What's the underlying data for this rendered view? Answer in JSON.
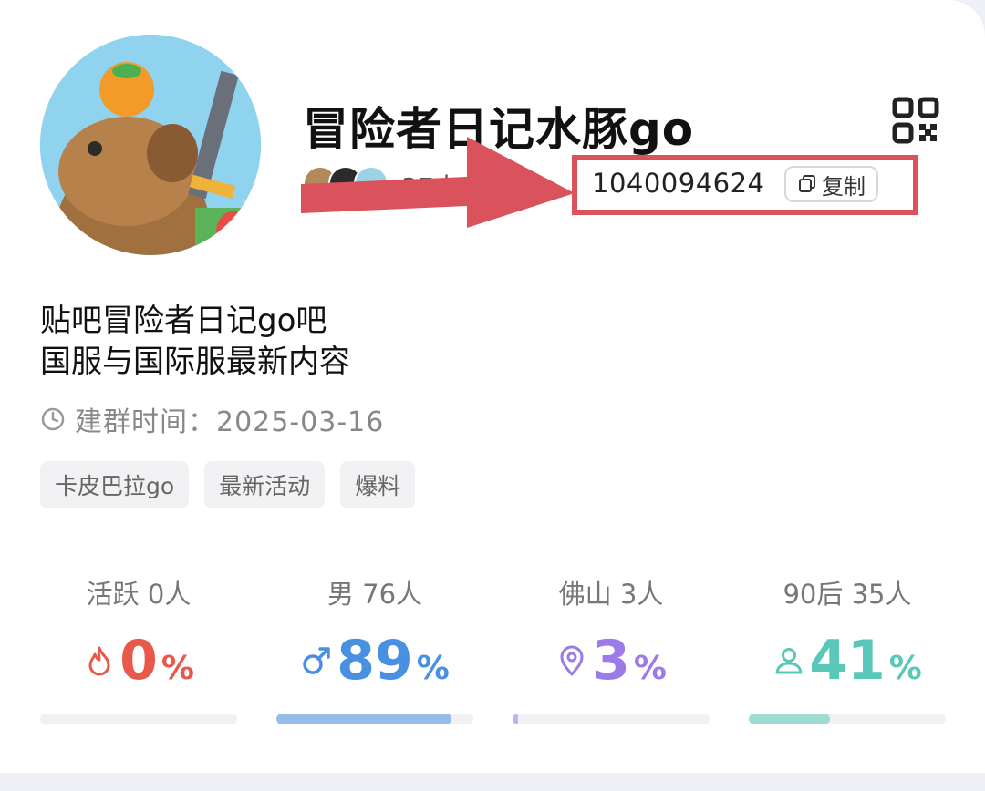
{
  "group": {
    "title": "冒险者日记水豚go",
    "member_count": "37人",
    "group_id": "1040094624",
    "copy_label": "复制",
    "description_lines": [
      "贴吧冒险者日记go吧",
      "国服与国际服最新内容"
    ],
    "created_label": "建群时间：2025-03-16"
  },
  "tags": [
    "卡皮巴拉go",
    "最新活动",
    "爆料"
  ],
  "stats": [
    {
      "label": "活跃 0人",
      "value": "0",
      "unit": "%",
      "percent": 0,
      "color": "#e8594a",
      "icon": "flame-icon"
    },
    {
      "label": "男 76人",
      "value": "89",
      "unit": "%",
      "percent": 89,
      "color": "#4a90e2",
      "icon": "male-icon"
    },
    {
      "label": "佛山 3人",
      "value": "3",
      "unit": "%",
      "percent": 3,
      "color": "#9b7be8",
      "icon": "location-pin-icon"
    },
    {
      "label": "90后 35人",
      "value": "41",
      "unit": "%",
      "percent": 41,
      "color": "#5ac8b8",
      "icon": "person-icon"
    }
  ],
  "colors": {
    "highlight_box": "#d9525c",
    "arrow": "#d9525c"
  }
}
